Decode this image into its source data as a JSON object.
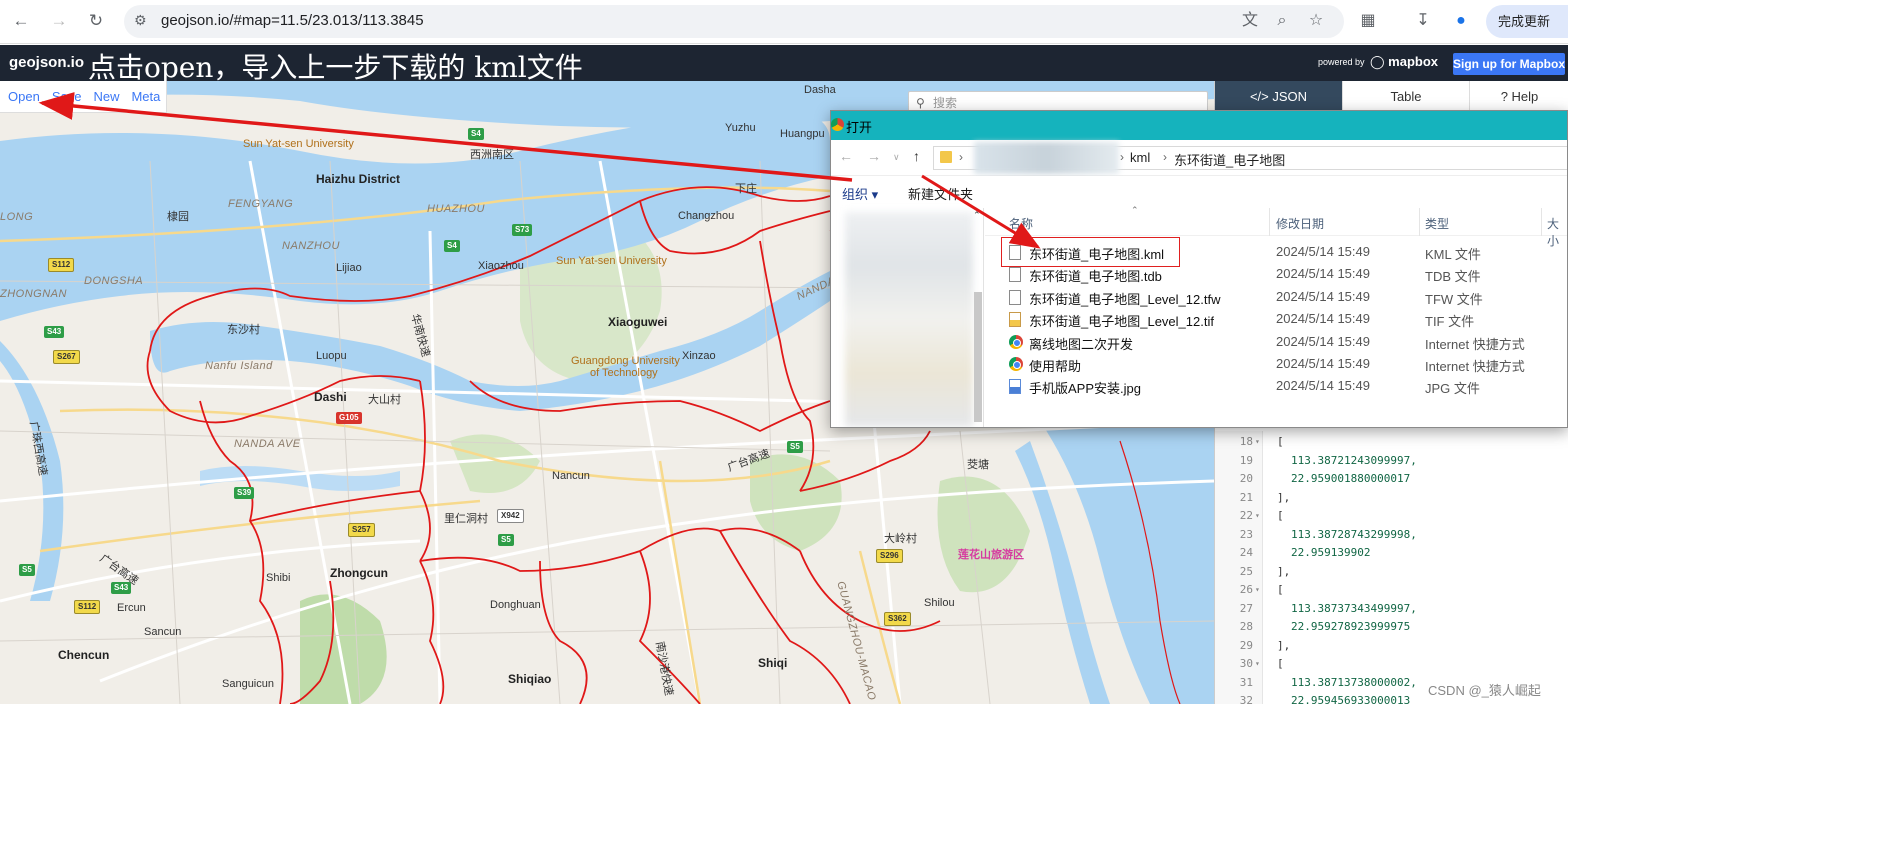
{
  "browser": {
    "url": "geojson.io/#map=11.5/23.013/113.3845",
    "update_button": "完成更新"
  },
  "app": {
    "brand": "geojson.io",
    "overlay_caption": "点击open，导入上一步下载的 kml文件",
    "powered_by": "powered by",
    "mapbox_logo": "mapbox",
    "signup_button": "Sign up for Mapbox"
  },
  "toolbar": {
    "open": "Open",
    "save": "Save",
    "new": "New",
    "meta": "Meta"
  },
  "search": {
    "placeholder": "搜索"
  },
  "panel": {
    "tabs": {
      "json": "</> JSON",
      "table": "Table",
      "help": "? Help"
    },
    "code_lines": [
      {
        "n": "18",
        "fold": true,
        "text": "[",
        "indent": 6,
        "type": "punct"
      },
      {
        "n": "19",
        "fold": false,
        "text": "113.38721243099997,",
        "indent": 8,
        "type": "num"
      },
      {
        "n": "20",
        "fold": false,
        "text": "22.959001880000017",
        "indent": 8,
        "type": "num"
      },
      {
        "n": "21",
        "fold": false,
        "text": "],",
        "indent": 6,
        "type": "punct"
      },
      {
        "n": "22",
        "fold": true,
        "text": "[",
        "indent": 6,
        "type": "punct"
      },
      {
        "n": "23",
        "fold": false,
        "text": "113.38728743299998,",
        "indent": 8,
        "type": "num"
      },
      {
        "n": "24",
        "fold": false,
        "text": "22.959139902",
        "indent": 8,
        "type": "num"
      },
      {
        "n": "25",
        "fold": false,
        "text": "],",
        "indent": 6,
        "type": "punct"
      },
      {
        "n": "26",
        "fold": true,
        "text": "[",
        "indent": 6,
        "type": "punct"
      },
      {
        "n": "27",
        "fold": false,
        "text": "113.38737343499997,",
        "indent": 8,
        "type": "num"
      },
      {
        "n": "28",
        "fold": false,
        "text": "22.959278923999975",
        "indent": 8,
        "type": "num"
      },
      {
        "n": "29",
        "fold": false,
        "text": "],",
        "indent": 6,
        "type": "punct"
      },
      {
        "n": "30",
        "fold": true,
        "text": "[",
        "indent": 6,
        "type": "punct"
      },
      {
        "n": "31",
        "fold": false,
        "text": "113.38713738000002,",
        "indent": 8,
        "type": "num"
      },
      {
        "n": "32",
        "fold": false,
        "text": "22.959456933000013",
        "indent": 8,
        "type": "num"
      }
    ]
  },
  "dialog": {
    "title": "打开",
    "breadcrumb": [
      "kml",
      "东环街道_电子地图"
    ],
    "organize": "组织 ▾",
    "new_folder": "新建文件夹",
    "columns": {
      "name": "名称",
      "modified": "修改日期",
      "type": "类型",
      "size": "大小"
    },
    "files": [
      {
        "name": "东环街道_电子地图.kml",
        "date": "2024/5/14 15:49",
        "type": "KML 文件",
        "icon": "file"
      },
      {
        "name": "东环街道_电子地图.tdb",
        "date": "2024/5/14 15:49",
        "type": "TDB 文件",
        "icon": "file"
      },
      {
        "name": "东环街道_电子地图_Level_12.tfw",
        "date": "2024/5/14 15:49",
        "type": "TFW 文件",
        "icon": "file"
      },
      {
        "name": "东环街道_电子地图_Level_12.tif",
        "date": "2024/5/14 15:49",
        "type": "TIF 文件",
        "icon": "tif"
      },
      {
        "name": "离线地图二次开发",
        "date": "2024/5/14 15:49",
        "type": "Internet 快捷方式",
        "icon": "chrome"
      },
      {
        "name": "使用帮助",
        "date": "2024/5/14 15:49",
        "type": "Internet 快捷方式",
        "icon": "chrome"
      },
      {
        "name": "手机版APP安装.jpg",
        "date": "2024/5/14 15:49",
        "type": "JPG 文件",
        "icon": "jpg"
      }
    ]
  },
  "map": {
    "labels": [
      {
        "t": "Dasha",
        "c": ""
      },
      {
        "t": "Yuzhu",
        "c": ""
      },
      {
        "t": "Huangpu",
        "c": ""
      },
      {
        "t": "Sun Yat-sen University",
        "c": "poi"
      },
      {
        "t": "西洲南区",
        "c": ""
      },
      {
        "t": "Haizhu District",
        "c": "bold"
      },
      {
        "t": "FENGYANG",
        "c": "ital"
      },
      {
        "t": "HUAZHOU",
        "c": "ital"
      },
      {
        "t": "下庄",
        "c": ""
      },
      {
        "t": "Changzhou",
        "c": ""
      },
      {
        "t": "LONG",
        "c": "ital"
      },
      {
        "t": "棣园",
        "c": ""
      },
      {
        "t": "NANZHOU",
        "c": "ital"
      },
      {
        "t": "Lijiao",
        "c": ""
      },
      {
        "t": "Xiaozhou",
        "c": ""
      },
      {
        "t": "Sun Yat-sen University",
        "c": "poi"
      },
      {
        "t": "ZHONGNAN",
        "c": "ital"
      },
      {
        "t": "DONGSHA",
        "c": "ital"
      },
      {
        "t": "NANDA",
        "c": "ital"
      },
      {
        "t": "东沙村",
        "c": ""
      },
      {
        "t": "华南快速",
        "c": ""
      },
      {
        "t": "Xiaoguwei",
        "c": "bold"
      },
      {
        "t": "Luopu",
        "c": ""
      },
      {
        "t": "Nanfu Island",
        "c": "ital"
      },
      {
        "t": "Guangdong University",
        "c": "poi"
      },
      {
        "t": "of Technology",
        "c": "poi"
      },
      {
        "t": "Xinzao",
        "c": ""
      },
      {
        "t": "Dashi",
        "c": "bold"
      },
      {
        "t": "大山村",
        "c": ""
      },
      {
        "t": "NANDA AVE",
        "c": "ital"
      },
      {
        "t": "广珠西高速",
        "c": ""
      },
      {
        "t": "Nancun",
        "c": ""
      },
      {
        "t": "广台高速",
        "c": ""
      },
      {
        "t": "茭塘",
        "c": ""
      },
      {
        "t": "里仁洞村",
        "c": ""
      },
      {
        "t": "Zhongcun",
        "c": "bold"
      },
      {
        "t": "Shibi",
        "c": ""
      },
      {
        "t": "大岭村",
        "c": ""
      },
      {
        "t": "莲花山旅游区",
        "c": "pink"
      },
      {
        "t": "广台高速",
        "c": ""
      },
      {
        "t": "Ercun",
        "c": ""
      },
      {
        "t": "Sancun",
        "c": ""
      },
      {
        "t": "Donghuan",
        "c": ""
      },
      {
        "t": "Shilou",
        "c": ""
      },
      {
        "t": "Chencun",
        "c": "bold"
      },
      {
        "t": "南沙港快速",
        "c": ""
      },
      {
        "t": "GUANGZHOU-MACAO EXPY",
        "c": "ital"
      },
      {
        "t": "Shiqi",
        "c": "bold"
      },
      {
        "t": "Shiqiao",
        "c": "bold"
      },
      {
        "t": "Sanguicun",
        "c": ""
      }
    ],
    "shields": [
      {
        "t": "S4",
        "c": "green"
      },
      {
        "t": "S112",
        "c": "yellow"
      },
      {
        "t": "S4",
        "c": "green"
      },
      {
        "t": "S73",
        "c": "green"
      },
      {
        "t": "S43",
        "c": "green"
      },
      {
        "t": "S267",
        "c": "yellow"
      },
      {
        "t": "G105",
        "c": "red"
      },
      {
        "t": "S5",
        "c": "green"
      },
      {
        "t": "S39",
        "c": "green"
      },
      {
        "t": "S257",
        "c": "yellow"
      },
      {
        "t": "X942",
        "c": "white"
      },
      {
        "t": "S5",
        "c": "green"
      },
      {
        "t": "S296",
        "c": "yellow"
      },
      {
        "t": "S5",
        "c": "green"
      },
      {
        "t": "S43",
        "c": "green"
      },
      {
        "t": "S112",
        "c": "yellow"
      },
      {
        "t": "S362",
        "c": "yellow"
      }
    ]
  },
  "watermark": "CSDN @_猿人崛起"
}
